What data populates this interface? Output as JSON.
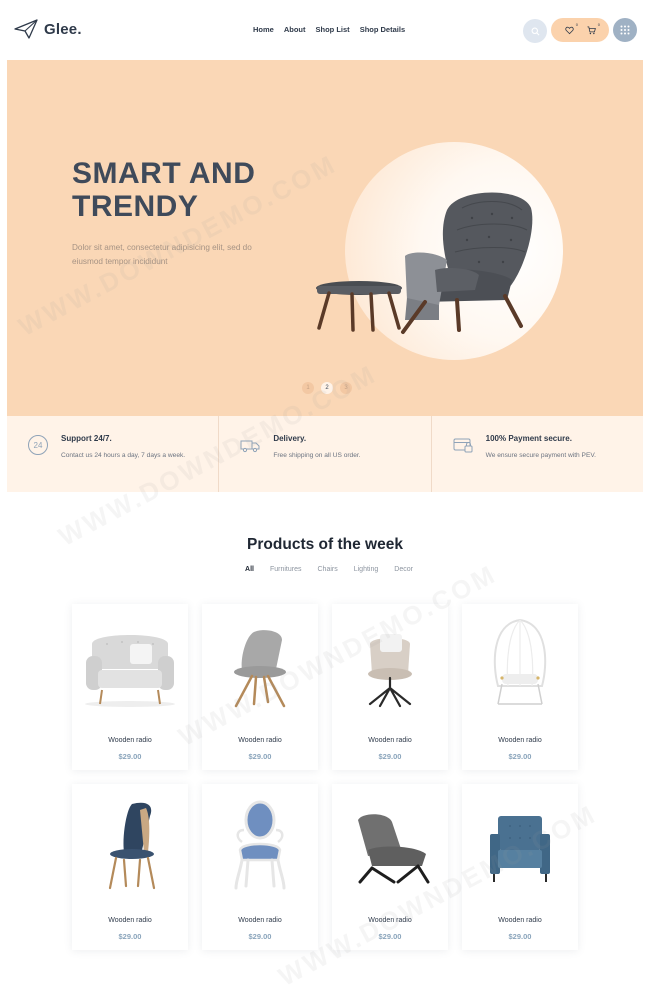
{
  "header": {
    "logo_text": "Glee.",
    "nav": [
      "Home",
      "About",
      "Shop List",
      "Shop Details"
    ],
    "wishlist_count": "0",
    "cart_count": "0"
  },
  "hero": {
    "title_line1": "SMART AND",
    "title_line2": "TRENDY",
    "description": "Dolor sit amet, consectetur adipisicing elit, sed do eiusmod tempor incididunt",
    "slides": [
      "1",
      "2",
      "3"
    ],
    "active_slide": "2"
  },
  "features": [
    {
      "icon": "support-24-icon",
      "title": "Support 24/7.",
      "desc": "Contact us 24 hours a day, 7 days a week."
    },
    {
      "icon": "delivery-truck-icon",
      "title": "Delivery.",
      "desc": "Free shipping on all US order."
    },
    {
      "icon": "payment-card-icon",
      "title": "100% Payment secure.",
      "desc": "We ensure secure payment with PEV."
    }
  ],
  "products_section": {
    "title": "Products of the week",
    "filters": [
      "All",
      "Furnitures",
      "Chairs",
      "Lighting",
      "Decor"
    ],
    "active_filter": "All",
    "products": [
      {
        "name": "Wooden radio",
        "price": "$29.00",
        "art": "sofa"
      },
      {
        "name": "Wooden radio",
        "price": "$29.00",
        "art": "grey-chair"
      },
      {
        "name": "Wooden radio",
        "price": "$29.00",
        "art": "swivel-chair"
      },
      {
        "name": "Wooden radio",
        "price": "$29.00",
        "art": "hanging-chair"
      },
      {
        "name": "Wooden radio",
        "price": "$29.00",
        "art": "blue-dining-chair"
      },
      {
        "name": "Wooden radio",
        "price": "$29.00",
        "art": "louis-chair"
      },
      {
        "name": "Wooden radio",
        "price": "$29.00",
        "art": "lounge-chair"
      },
      {
        "name": "Wooden radio",
        "price": "$29.00",
        "art": "blue-armchair"
      }
    ]
  },
  "colors": {
    "accent_peach": "#fad7b6",
    "feature_bg": "#fff3e8",
    "price_blue": "#8aa4bb",
    "heading_dark": "#3f4a5a"
  },
  "watermark": "WWW.DOWNDEMO.COM"
}
